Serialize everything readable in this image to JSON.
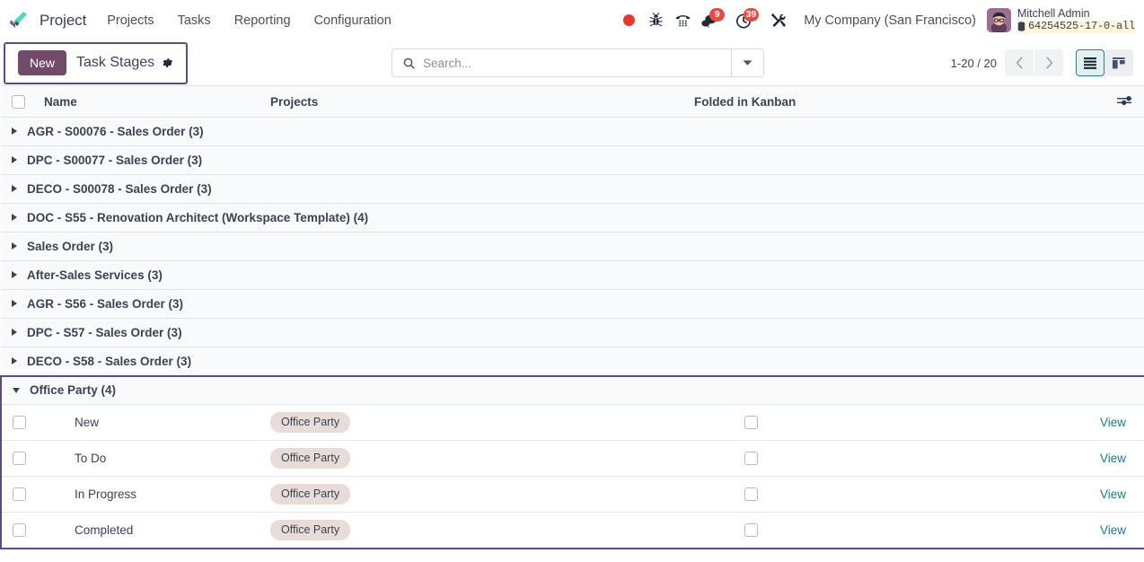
{
  "navbar": {
    "brand": "Project",
    "logo_icon": "project-checkmark-logo",
    "menu": [
      {
        "label": "Projects"
      },
      {
        "label": "Tasks"
      },
      {
        "label": "Reporting"
      },
      {
        "label": "Configuration"
      }
    ],
    "sys_icons": [
      {
        "name": "recording-dot-icon",
        "badge": ""
      },
      {
        "name": "bug-icon",
        "badge": ""
      },
      {
        "name": "phone-dialpad-icon",
        "badge": ""
      },
      {
        "name": "messages-icon",
        "badge": "9"
      },
      {
        "name": "activities-clock-icon",
        "badge": "39"
      },
      {
        "name": "tools-icon",
        "badge": ""
      }
    ],
    "company": "My Company (San Francisco)",
    "user_name": "Mitchell Admin",
    "user_db": "64254525-17-0-all",
    "db_icon": "database-icon"
  },
  "control_panel": {
    "new_label": "New",
    "breadcrumb_title": "Task Stages",
    "gear_icon": "gear-icon",
    "search_placeholder": "Search...",
    "search_value": "",
    "search_icon": "search-icon",
    "search_toggle_icon": "chevron-down-icon",
    "pager": "1-20 / 20",
    "prev_icon": "chevron-left-icon",
    "next_icon": "chevron-right-icon",
    "view_list_icon": "list-view-icon",
    "view_kanban_icon": "kanban-view-icon",
    "active_view": "list"
  },
  "table": {
    "headers": {
      "name": "Name",
      "projects": "Projects",
      "folded": "Folded in Kanban",
      "options_icon": "column-options-icon"
    },
    "groups": [
      {
        "label": "AGR - S00076 - Sales Order (3)",
        "expanded": false,
        "highlighted": false
      },
      {
        "label": "DPC - S00077 - Sales Order (3)",
        "expanded": false,
        "highlighted": false
      },
      {
        "label": "DECO - S00078 - Sales Order (3)",
        "expanded": false,
        "highlighted": false
      },
      {
        "label": "DOC - S55 - Renovation Architect (Workspace Template) (4)",
        "expanded": false,
        "highlighted": false
      },
      {
        "label": "Sales Order (3)",
        "expanded": false,
        "highlighted": false
      },
      {
        "label": "After-Sales Services (3)",
        "expanded": false,
        "highlighted": false
      },
      {
        "label": "AGR - S56 - Sales Order (3)",
        "expanded": false,
        "highlighted": false
      },
      {
        "label": "DPC - S57 - Sales Order (3)",
        "expanded": false,
        "highlighted": false
      },
      {
        "label": "DECO - S58 - Sales Order (3)",
        "expanded": false,
        "highlighted": false
      },
      {
        "label": "Office Party (4)",
        "expanded": true,
        "highlighted": true
      }
    ],
    "rows": [
      {
        "name": "New",
        "project_tag": "Office Party",
        "folded": false,
        "action": "View"
      },
      {
        "name": "To Do",
        "project_tag": "Office Party",
        "folded": false,
        "action": "View"
      },
      {
        "name": "In Progress",
        "project_tag": "Office Party",
        "folded": false,
        "action": "View"
      },
      {
        "name": "Completed",
        "project_tag": "Office Party",
        "folded": false,
        "action": "View"
      }
    ]
  },
  "colors": {
    "primary": "#714b67",
    "accent_teal": "#1a7b87",
    "highlight_border": "#5b4b87",
    "badge_red": "#e94a43",
    "tag_bg": "#e8dcd8"
  }
}
